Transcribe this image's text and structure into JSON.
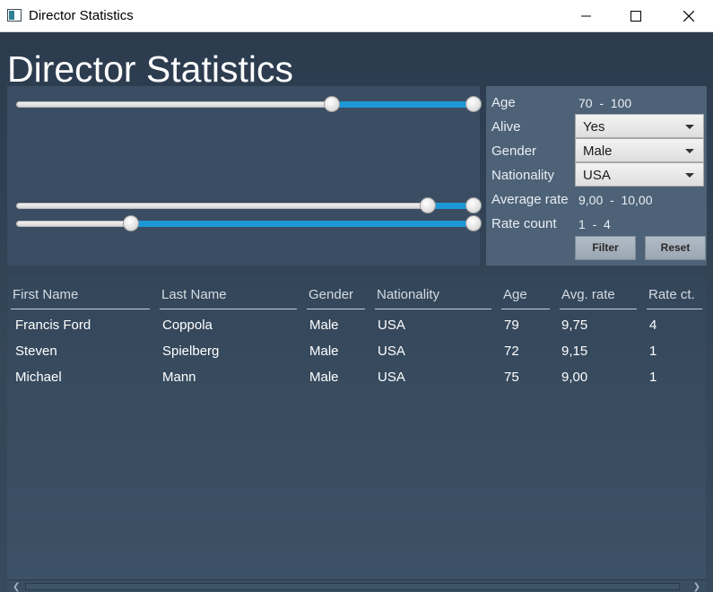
{
  "window": {
    "title": "Director Statistics",
    "minimize_icon": "minimize-icon",
    "maximize_icon": "maximize-icon",
    "close_icon": "close-icon"
  },
  "page": {
    "title": "Director Statistics"
  },
  "sliders": [
    {
      "name": "age-range-slider",
      "low": 0.69,
      "high": 1.0
    },
    {
      "name": "average-rate-range-slider",
      "low": 0.9,
      "high": 1.0
    },
    {
      "name": "rate-count-range-slider",
      "low": 0.25,
      "high": 1.0
    }
  ],
  "filters": {
    "age": {
      "label": "Age",
      "value": "70  -  100"
    },
    "alive": {
      "label": "Alive",
      "value": "Yes"
    },
    "gender": {
      "label": "Gender",
      "value": "Male"
    },
    "nationality": {
      "label": "Nationality",
      "value": "USA"
    },
    "average_rate": {
      "label": "Average rate",
      "value": "9,00  -  10,00"
    },
    "rate_count": {
      "label": "Rate count",
      "value": "1  -  4"
    },
    "filter_button": "Filter",
    "reset_button": "Reset"
  },
  "table": {
    "columns": [
      "First Name",
      "Last Name",
      "Gender",
      "Nationality",
      "Age",
      "Avg. rate",
      "Rate ct."
    ],
    "rows": [
      [
        "Francis Ford",
        "Coppola",
        "Male",
        "USA",
        "79",
        "9,75",
        "4"
      ],
      [
        "Steven",
        "Spielberg",
        "Male",
        "USA",
        "72",
        "9,15",
        "1"
      ],
      [
        "Michael",
        "Mann",
        "Male",
        "USA",
        "75",
        "9,00",
        "1"
      ]
    ]
  },
  "colors": {
    "accent": "#1d98d6",
    "background": "#2b3a4c",
    "panel": "#3a4d62",
    "filter_panel": "#4d6277"
  }
}
